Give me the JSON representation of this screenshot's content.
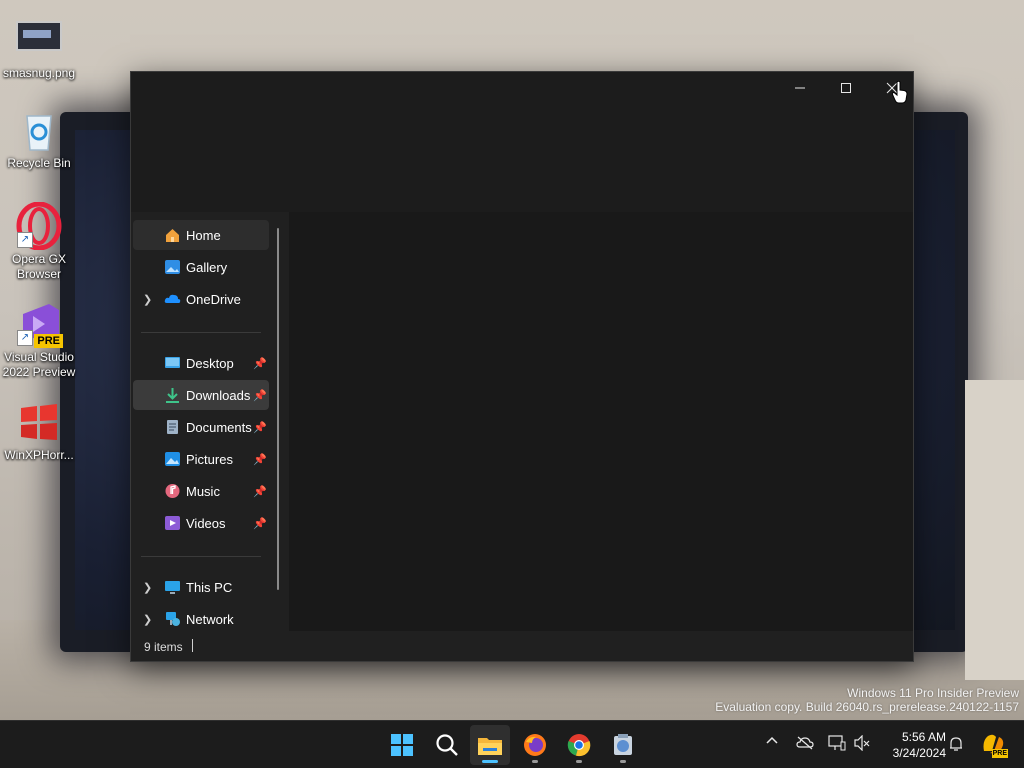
{
  "desktop": {
    "icons": [
      {
        "label": "smasnug.png"
      },
      {
        "label": "Recycle Bin"
      },
      {
        "label": "Opera GX Browser"
      },
      {
        "label": "Visual Studio 2022 Preview",
        "badge": "PRE"
      },
      {
        "label": "WinXPHorr..."
      }
    ],
    "watermark": {
      "line1": "Windows 11 Pro Insider Preview",
      "line2": "Evaluation copy. Build 26040.rs_prerelease.240122-1157"
    }
  },
  "explorer": {
    "window_controls": {
      "minimize": "minimize",
      "maximize": "maximize",
      "close": "close"
    },
    "nav": [
      {
        "label": "Home",
        "icon": "home-icon",
        "state": "selected"
      },
      {
        "label": "Gallery",
        "icon": "gallery-icon"
      },
      {
        "label": "OneDrive",
        "icon": "onedrive-icon",
        "expandable": true
      },
      {
        "label": "Desktop",
        "icon": "desktop-folder-icon",
        "pinned": true
      },
      {
        "label": "Downloads",
        "icon": "downloads-icon",
        "pinned": true,
        "state": "active"
      },
      {
        "label": "Documents",
        "icon": "documents-icon",
        "pinned": true
      },
      {
        "label": "Pictures",
        "icon": "pictures-icon",
        "pinned": true
      },
      {
        "label": "Music",
        "icon": "music-icon",
        "pinned": true
      },
      {
        "label": "Videos",
        "icon": "videos-icon",
        "pinned": true
      },
      {
        "label": "This PC",
        "icon": "this-pc-icon",
        "expandable": true
      },
      {
        "label": "Network",
        "icon": "network-icon",
        "expandable": true
      }
    ],
    "status": {
      "item_count": "9 items"
    }
  },
  "taskbar": {
    "apps": [
      "start-icon",
      "search-icon",
      "file-explorer-icon",
      "firefox-icon",
      "chrome-icon",
      "app-icon"
    ],
    "clock": {
      "time": "5:56 AM",
      "date": "3/24/2024"
    },
    "copilot_badge": "PRE"
  },
  "colors": {
    "accent": "#4cc2ff",
    "window_bg": "#202020",
    "taskbar_bg": "#1c1c1c"
  }
}
